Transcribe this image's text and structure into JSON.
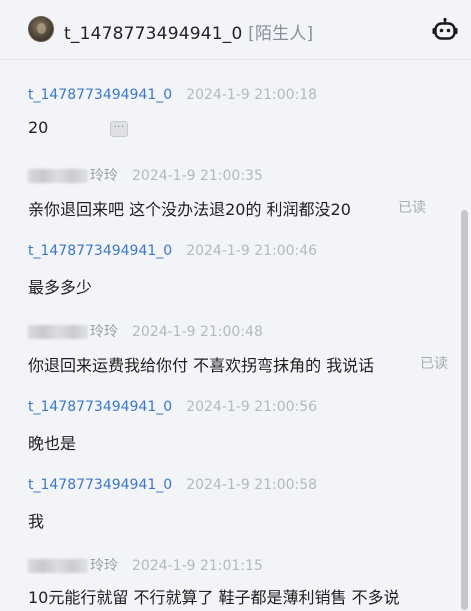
{
  "header": {
    "chat_name": "t_1478773494941_0",
    "stranger_tag": "[陌生人]",
    "avatar_icon": "user-avatar",
    "robot_icon": "robot-icon"
  },
  "messages": [
    {
      "sender": "t_1478773494941_0",
      "time": "2024-1-9 21:00:18",
      "text": "20",
      "read": ""
    },
    {
      "sender": "玲玲",
      "time": "2024-1-9 21:00:35",
      "text": "亲你退回来吧  这个没办法退20的 利润都没20",
      "read": "已读"
    },
    {
      "sender": "t_1478773494941_0",
      "time": "2024-1-9 21:00:46",
      "text": "最多多少",
      "read": ""
    },
    {
      "sender": "玲玲",
      "time": "2024-1-9 21:00:48",
      "text": "你退回来运费我给你付 不喜欢拐弯抹角的 我说话",
      "read": "已读"
    },
    {
      "sender": "t_1478773494941_0",
      "time": "2024-1-9 21:00:56",
      "text": "晚也是",
      "read": ""
    },
    {
      "sender": "t_1478773494941_0",
      "time": "2024-1-9 21:00:58",
      "text": "我",
      "read": ""
    },
    {
      "sender": "玲玲",
      "time": "2024-1-9 21:01:15",
      "text": "10元能行就留 不行就算了  鞋子都是薄利销售  不多说",
      "read": ""
    }
  ],
  "more_button": "···"
}
